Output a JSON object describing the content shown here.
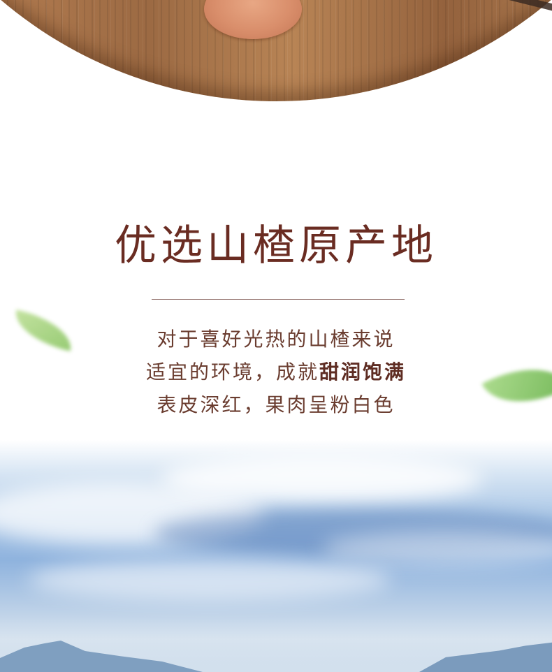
{
  "title": "优选山楂原产地",
  "description": {
    "line1": "对于喜好光热的山楂来说",
    "line2_normal": "适宜的环境，成就",
    "line2_bold": "甜润饱满",
    "line3": "表皮深红，果肉呈粉白色"
  },
  "colors": {
    "title": "#6a2c22",
    "body": "#6a3c2f",
    "divider": "#8c6a64",
    "sky": "#8fb3de",
    "wood": "#a8744a"
  }
}
